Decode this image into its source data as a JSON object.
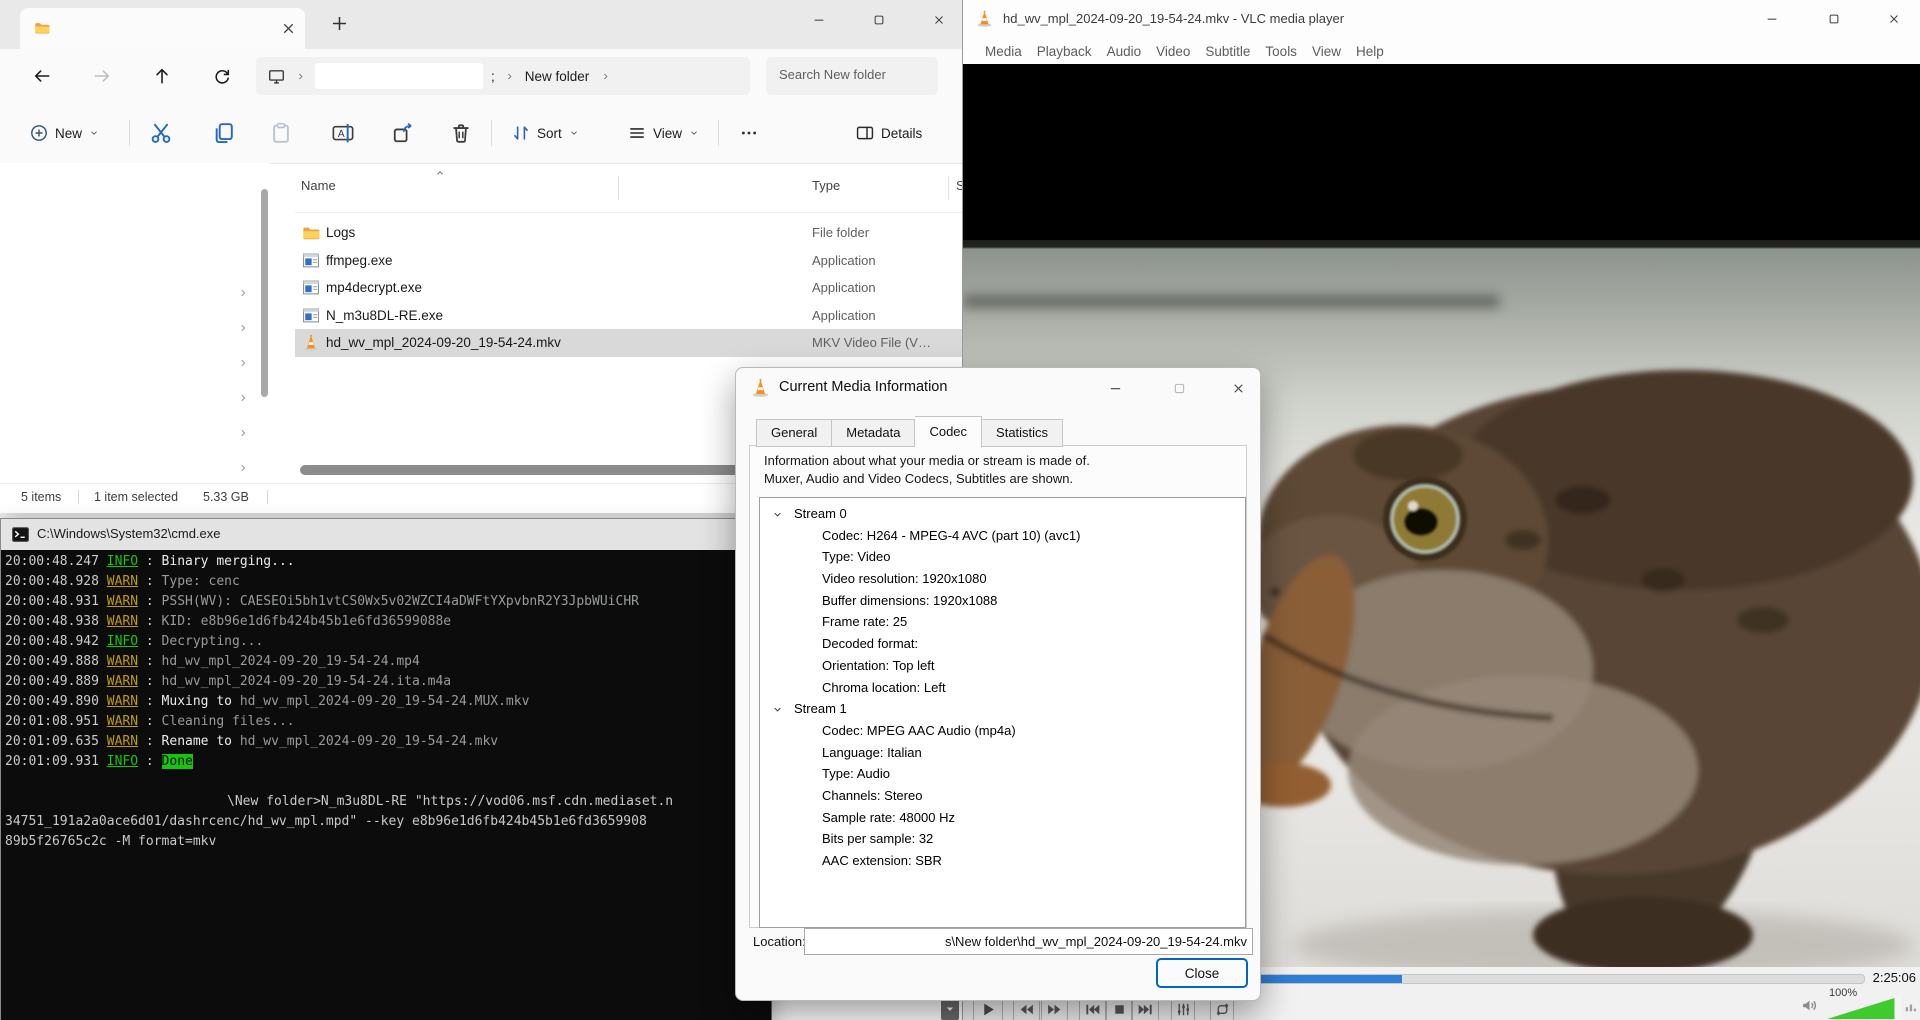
{
  "colors": {
    "accent_blue": "#0067c0",
    "seek_fill": "#2e7fd6",
    "info_green": "#16c60c",
    "warn_yellow": "#c19c00",
    "done_bg": "#16c60c",
    "selected_row": "#d9d9d9",
    "volume_green": "#3fcb2d"
  },
  "explorer": {
    "tab_title": "",
    "nav": {
      "breadcrumb_residue": ";",
      "breadcrumb": "New folder",
      "search_placeholder": "Search New folder"
    },
    "toolbar": {
      "new_label": "New",
      "sort_label": "Sort",
      "view_label": "View",
      "details_label": "Details",
      "icon_buttons": [
        "cut",
        "copy",
        "paste",
        "rename",
        "share",
        "delete"
      ]
    },
    "columns": {
      "name": "Name",
      "type": "Type",
      "size": "Size"
    },
    "files": [
      {
        "name": "Logs",
        "type": "File folder",
        "icon": "folder",
        "selected": false
      },
      {
        "name": "ffmpeg.exe",
        "type": "Application",
        "icon": "app",
        "selected": false
      },
      {
        "name": "mp4decrypt.exe",
        "type": "Application",
        "icon": "app",
        "selected": false
      },
      {
        "name": "N_m3u8DL-RE.exe",
        "type": "Application",
        "icon": "app",
        "selected": false
      },
      {
        "name": "hd_wv_mpl_2024-09-20_19-54-24.mkv",
        "type": "MKV Video File (V…",
        "icon": "cone",
        "selected": true
      }
    ],
    "status": {
      "count": "5 items",
      "selection": "1 item selected",
      "size": "5.33 GB"
    }
  },
  "cmd": {
    "title": "C:\\Windows\\System32\\cmd.exe",
    "log": [
      {
        "t": "20:00:48.247",
        "lvl": "INFO",
        "parts": [
          [
            "bright",
            "Binary merging..."
          ]
        ]
      },
      {
        "t": "20:00:48.928",
        "lvl": "WARN",
        "parts": [
          [
            "dim",
            "Type: cenc"
          ]
        ]
      },
      {
        "t": "20:00:48.931",
        "lvl": "WARN",
        "parts": [
          [
            "dim",
            "PSSH(WV): CAESEOi5bh1vtCS0Wx5v02WZCI4aDWFtYXpvbnR2Y3JpbWUiCHR"
          ]
        ]
      },
      {
        "t": "20:00:48.938",
        "lvl": "WARN",
        "parts": [
          [
            "dim",
            "KID: e8b96e1d6fb424b45b1e6fd36599088e"
          ]
        ]
      },
      {
        "t": "20:00:48.942",
        "lvl": "INFO",
        "parts": [
          [
            "dim",
            "Decrypting..."
          ]
        ]
      },
      {
        "t": "20:00:49.888",
        "lvl": "WARN",
        "parts": [
          [
            "dim",
            "hd_wv_mpl_2024-09-20_19-54-24.mp4"
          ]
        ]
      },
      {
        "t": "20:00:49.889",
        "lvl": "WARN",
        "parts": [
          [
            "dim",
            "hd_wv_mpl_2024-09-20_19-54-24.ita.m4a"
          ]
        ]
      },
      {
        "t": "20:00:49.890",
        "lvl": "WARN",
        "parts": [
          [
            "bright",
            "Muxing to "
          ],
          [
            "dim",
            "hd_wv_mpl_2024-09-20_19-54-24.MUX.mkv"
          ]
        ]
      },
      {
        "t": "20:01:08.951",
        "lvl": "WARN",
        "parts": [
          [
            "dim",
            "Cleaning files..."
          ]
        ]
      },
      {
        "t": "20:01:09.635",
        "lvl": "WARN",
        "parts": [
          [
            "bright",
            "Rename to "
          ],
          [
            "dim",
            "hd_wv_mpl_2024-09-20_19-54-24.mkv"
          ]
        ]
      },
      {
        "t": "20:01:09.931",
        "lvl": "INFO",
        "parts": [
          [
            "done",
            "Done"
          ]
        ]
      }
    ],
    "prompt": [
      "\\New folder>N_m3u8DL-RE \"https://vod06.msf.cdn.mediaset.n",
      "34751_191a2a0ace6d01/dashrcenc/hd_wv_mpl.mpd\" --key e8b96e1d6fb424b45b1e6fd3659908",
      "89b5f26765c2c -M format=mkv"
    ]
  },
  "vlc": {
    "title": "hd_wv_mpl_2024-09-20_19-54-24.mkv - VLC media player",
    "menu": [
      "Media",
      "Playback",
      "Audio",
      "Video",
      "Subtitle",
      "Tools",
      "View",
      "Help"
    ],
    "time": "2:25:06",
    "volume_label": "100%",
    "progress_pct": 48,
    "controls": [
      "play",
      "slower",
      "faster",
      "previous",
      "stop",
      "next",
      "equalizer",
      "loop"
    ]
  },
  "dialog": {
    "title": "Current Media Information",
    "tabs": [
      "General",
      "Metadata",
      "Codec",
      "Statistics"
    ],
    "active_tab": "Codec",
    "description": [
      "Information about what your media or stream is made of.",
      "Muxer, Audio and Video Codecs, Subtitles are shown."
    ],
    "streams": [
      {
        "label": "Stream 0",
        "props": [
          "Codec: H264 - MPEG-4 AVC (part 10) (avc1)",
          "Type: Video",
          "Video resolution: 1920x1080",
          "Buffer dimensions: 1920x1088",
          "Frame rate: 25",
          "Decoded format:",
          "Orientation: Top left",
          "Chroma location: Left"
        ]
      },
      {
        "label": "Stream 1",
        "props": [
          "Codec: MPEG AAC Audio (mp4a)",
          "Language: Italian",
          "Type: Audio",
          "Channels: Stereo",
          "Sample rate: 48000 Hz",
          "Bits per sample: 32",
          "AAC extension: SBR"
        ]
      }
    ],
    "location_label": "Location:",
    "location_value": "s\\New folder\\hd_wv_mpl_2024-09-20_19-54-24.mkv",
    "close_label": "Close"
  }
}
